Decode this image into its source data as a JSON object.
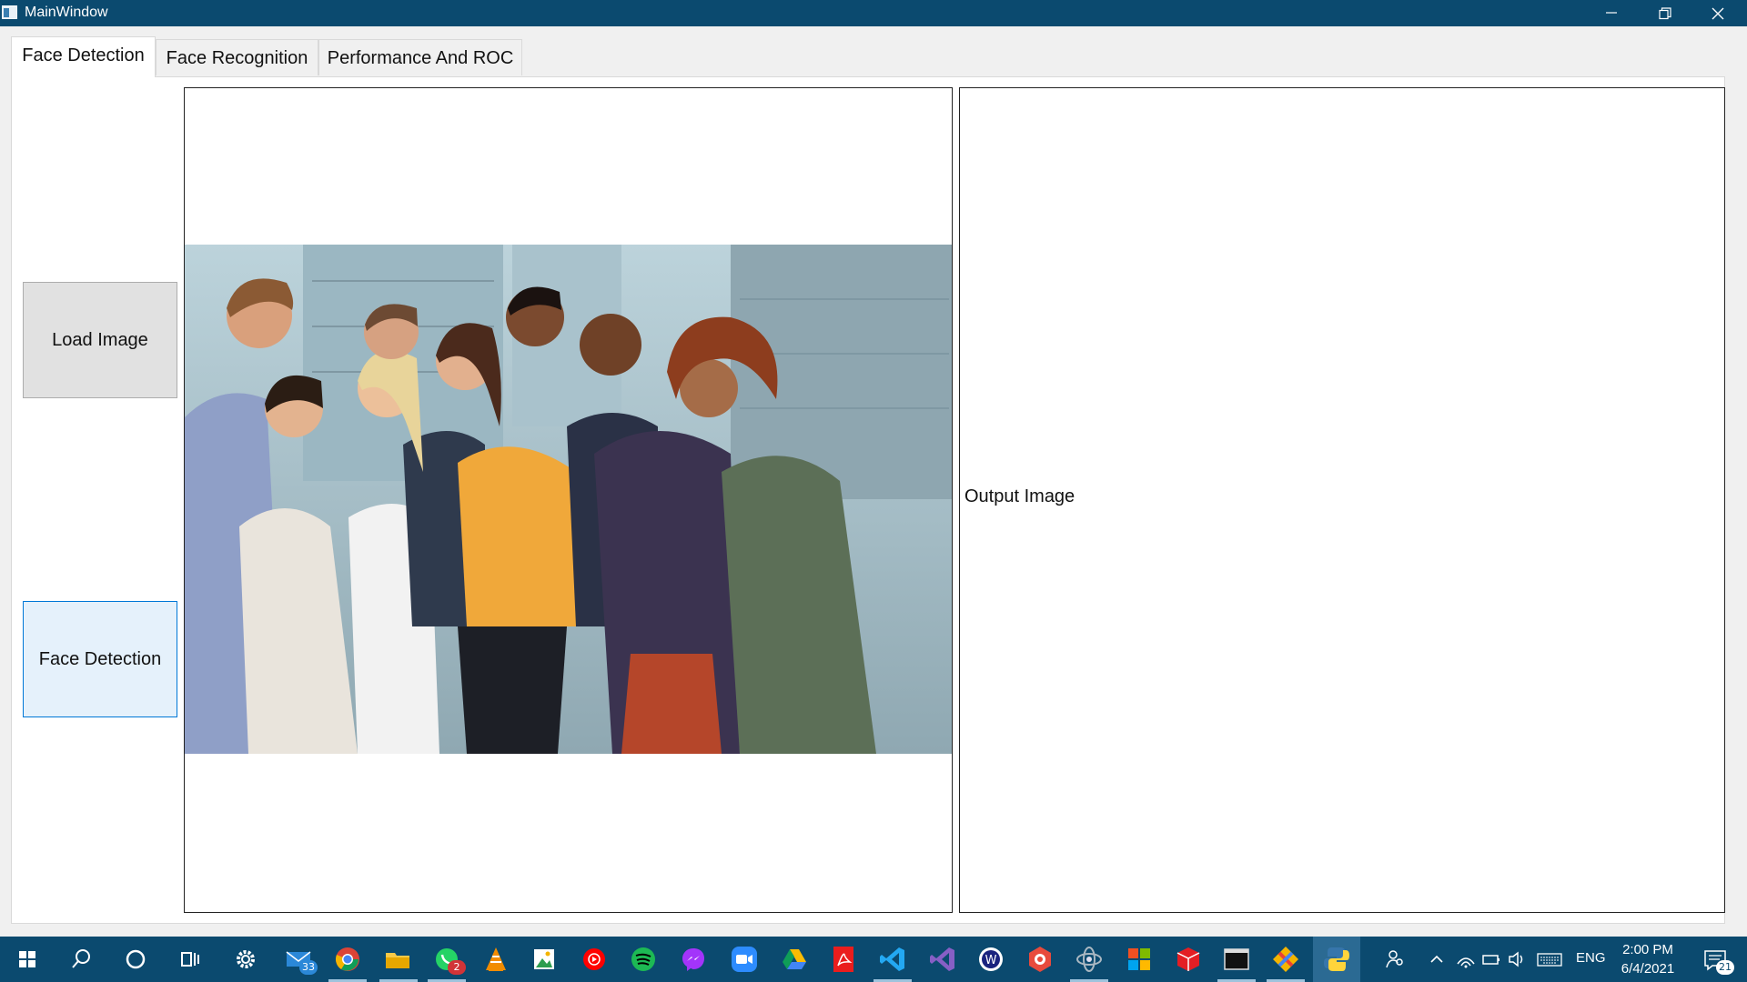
{
  "window": {
    "title": "MainWindow",
    "app_icon": "window-app-icon",
    "controls": [
      "minimize-icon",
      "restore-icon",
      "close-icon"
    ]
  },
  "tabs": [
    {
      "label": "Face Detection",
      "active": true
    },
    {
      "label": "Face Recognition",
      "active": false
    },
    {
      "label": "Performance And ROC",
      "active": false
    }
  ],
  "buttons": {
    "load_image": "Load Image",
    "face_detection": "Face Detection"
  },
  "input_image": {
    "description_icon": "group-photo-image"
  },
  "output_image": {
    "label": "Output Image"
  },
  "taskbar": {
    "apps": [
      {
        "name": "start-icon"
      },
      {
        "name": "search-icon"
      },
      {
        "name": "cortana-icon"
      },
      {
        "name": "task-view-icon"
      },
      {
        "name": "settings-icon"
      },
      {
        "name": "mail-icon",
        "badge": "33"
      },
      {
        "name": "chrome-icon"
      },
      {
        "name": "file-explorer-icon"
      },
      {
        "name": "whatsapp-icon",
        "badge": "2"
      },
      {
        "name": "vlc-icon"
      },
      {
        "name": "image-viewer-icon"
      },
      {
        "name": "youtube-music-icon"
      },
      {
        "name": "spotify-icon"
      },
      {
        "name": "messenger-icon"
      },
      {
        "name": "zoom-icon"
      },
      {
        "name": "google-drive-icon"
      },
      {
        "name": "acrobat-icon"
      },
      {
        "name": "vscode-icon"
      },
      {
        "name": "visual-studio-icon"
      },
      {
        "name": "app-w-icon"
      },
      {
        "name": "app-red-icon"
      },
      {
        "name": "qt-designer-icon"
      },
      {
        "name": "ms-office-icon"
      },
      {
        "name": "3d-box-icon"
      },
      {
        "name": "terminal-icon"
      },
      {
        "name": "git-icon"
      },
      {
        "name": "python-icon"
      }
    ],
    "tray": {
      "language": "ENG",
      "time": "2:00 PM",
      "date": "6/4/2021",
      "notifications": "21"
    },
    "colors": {
      "bar": "#0b4a6f",
      "accent": "#0078d7"
    }
  }
}
